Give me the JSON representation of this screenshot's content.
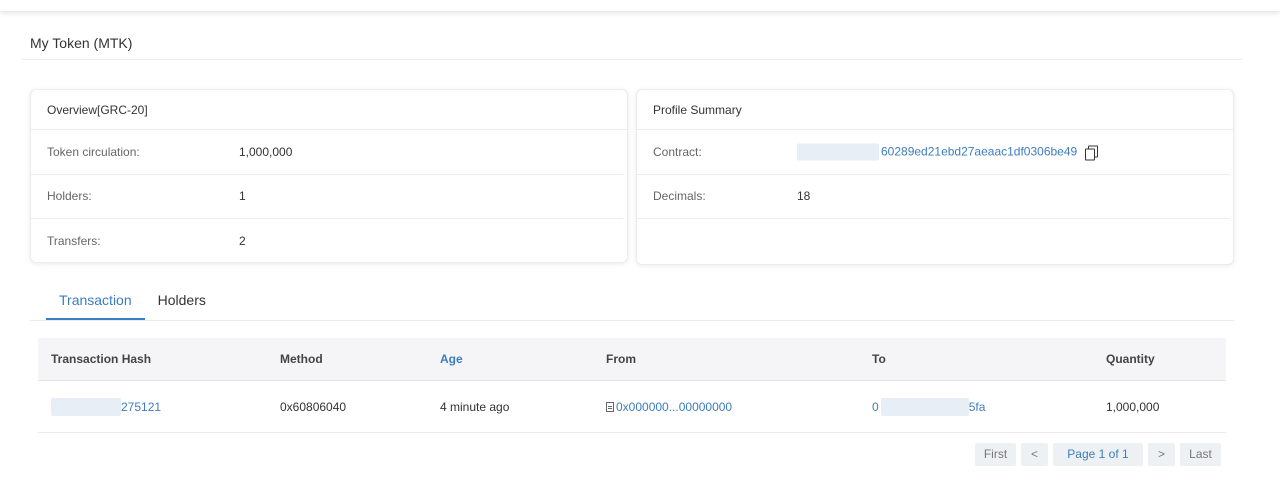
{
  "page_title": "My Token (MTK)",
  "overview": {
    "header": "Overview[GRC-20]",
    "rows": [
      {
        "label": "Token circulation:",
        "value": "1,000,000"
      },
      {
        "label": "Holders:",
        "value": "1"
      },
      {
        "label": "Transfers:",
        "value": "2"
      }
    ]
  },
  "profile": {
    "header": "Profile Summary",
    "contract_label": "Contract:",
    "contract_value": "60289ed21ebd27aeaac1df0306be49",
    "decimals_label": "Decimals:",
    "decimals_value": "18"
  },
  "tabs": [
    {
      "label": "Transaction",
      "active": true
    },
    {
      "label": "Holders",
      "active": false
    }
  ],
  "table": {
    "headers": [
      "Transaction Hash",
      "Method",
      "Age",
      "From",
      "To",
      "Quantity"
    ],
    "rows": [
      {
        "hash_suffix": "275121",
        "method": "0x60806040",
        "age": "4 minute ago",
        "from": "0x000000...00000000",
        "to_prefix": "0",
        "to_suffix": "5fa",
        "quantity": "1,000,000"
      }
    ]
  },
  "pagination": {
    "first": "First",
    "prev": "<",
    "current": "Page 1 of 1",
    "next": ">",
    "last": "Last"
  },
  "colors": {
    "link": "#3c7dbf",
    "header_bg": "#f5f5f7",
    "pager_bg": "#eef1f4"
  }
}
